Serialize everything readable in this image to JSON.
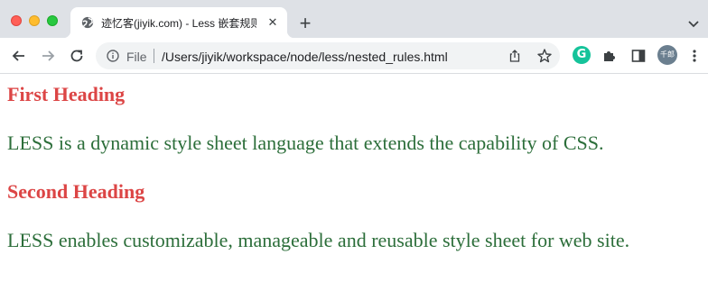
{
  "tab": {
    "title": "迹忆客(jiyik.com) - Less 嵌套规则",
    "close_glyph": "✕",
    "favicon": "globe-icon"
  },
  "toolbar": {
    "new_tab_glyph": "+",
    "back_icon": "arrow-left-icon",
    "forward_icon": "arrow-right-icon",
    "reload_icon": "reload-icon"
  },
  "omnibox": {
    "scheme_label": "File",
    "url": "/Users/jiyik/workspace/node/less/nested_rules.html"
  },
  "extensions": {
    "grammarly_letter": "G",
    "profile_initials": "千郎"
  },
  "page": {
    "heading1": "First Heading",
    "paragraph1": "LESS is a dynamic style sheet language that extends the capability of CSS.",
    "heading2": "Second Heading",
    "paragraph2": "LESS enables customizable, manageable and reusable style sheet for web site."
  },
  "colors": {
    "heading": "#dc4545",
    "paragraph": "#2c6e3a",
    "tabstrip": "#dee1e6"
  }
}
